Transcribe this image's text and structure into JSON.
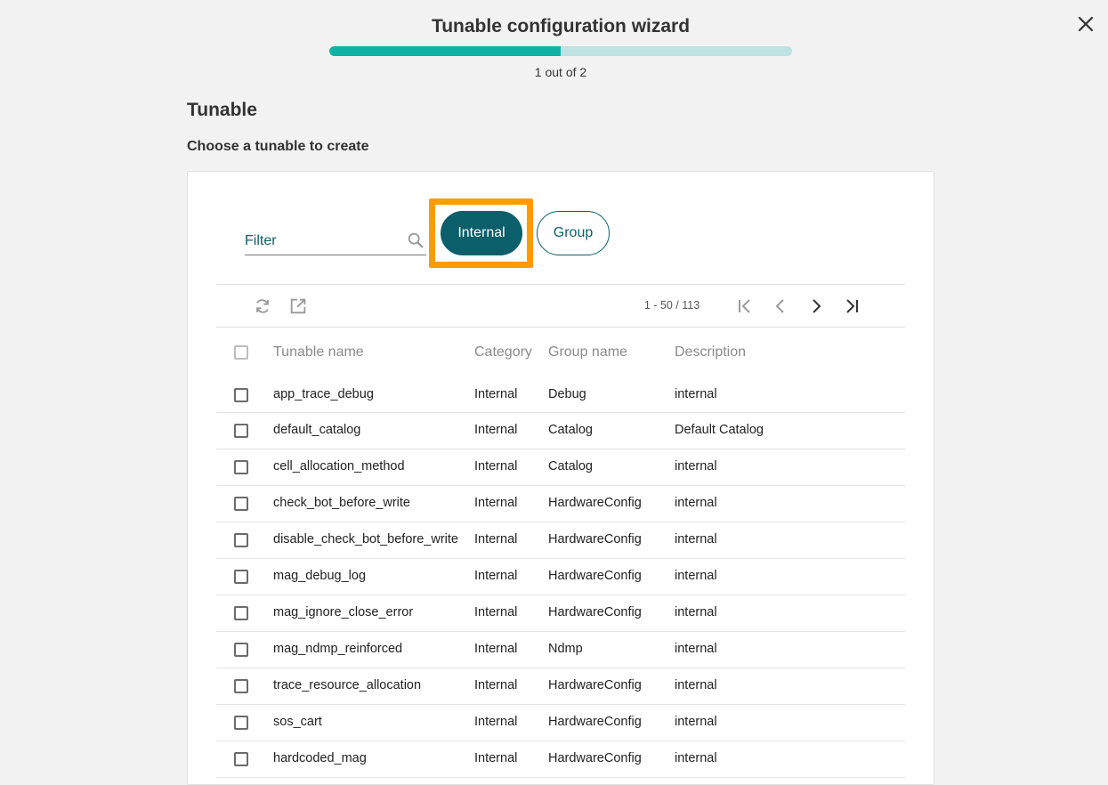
{
  "wizard": {
    "title": "Tunable configuration wizard",
    "step_text": "1 out of 2",
    "progress": 0.5
  },
  "section": {
    "title": "Tunable",
    "subtitle": "Choose a tunable to create"
  },
  "filter": {
    "placeholder": "Filter"
  },
  "chips": {
    "internal": "Internal",
    "group": "Group"
  },
  "pager": {
    "range_text": "1 - 50 / 113"
  },
  "table": {
    "headers": {
      "name": "Tunable name",
      "category": "Category",
      "group": "Group name",
      "description": "Description"
    },
    "rows": [
      {
        "name": "app_trace_debug",
        "category": "Internal",
        "group": "Debug",
        "description": "internal"
      },
      {
        "name": "default_catalog",
        "category": "Internal",
        "group": "Catalog",
        "description": "Default Catalog"
      },
      {
        "name": "cell_allocation_method",
        "category": "Internal",
        "group": "Catalog",
        "description": "internal"
      },
      {
        "name": "check_bot_before_write",
        "category": "Internal",
        "group": "HardwareConfig",
        "description": "internal"
      },
      {
        "name": "disable_check_bot_before_write",
        "category": "Internal",
        "group": "HardwareConfig",
        "description": "internal"
      },
      {
        "name": "mag_debug_log",
        "category": "Internal",
        "group": "HardwareConfig",
        "description": "internal"
      },
      {
        "name": "mag_ignore_close_error",
        "category": "Internal",
        "group": "HardwareConfig",
        "description": "internal"
      },
      {
        "name": "mag_ndmp_reinforced",
        "category": "Internal",
        "group": "Ndmp",
        "description": "internal"
      },
      {
        "name": "trace_resource_allocation",
        "category": "Internal",
        "group": "HardwareConfig",
        "description": "internal"
      },
      {
        "name": "sos_cart",
        "category": "Internal",
        "group": "HardwareConfig",
        "description": "internal"
      },
      {
        "name": "hardcoded_mag",
        "category": "Internal",
        "group": "HardwareConfig",
        "description": "internal"
      }
    ]
  },
  "colors": {
    "accent": "#0b5f6b",
    "progress_fill": "#10b2a6",
    "progress_track": "#bfe2e3",
    "highlight": "#ff9d00"
  },
  "icons": {
    "close": "close-icon",
    "search": "search-icon",
    "refresh": "refresh-icon",
    "export": "open-in-new-icon",
    "first": "first-page-icon",
    "prev": "chevron-left-icon",
    "next": "chevron-right-icon",
    "last": "last-page-icon"
  }
}
